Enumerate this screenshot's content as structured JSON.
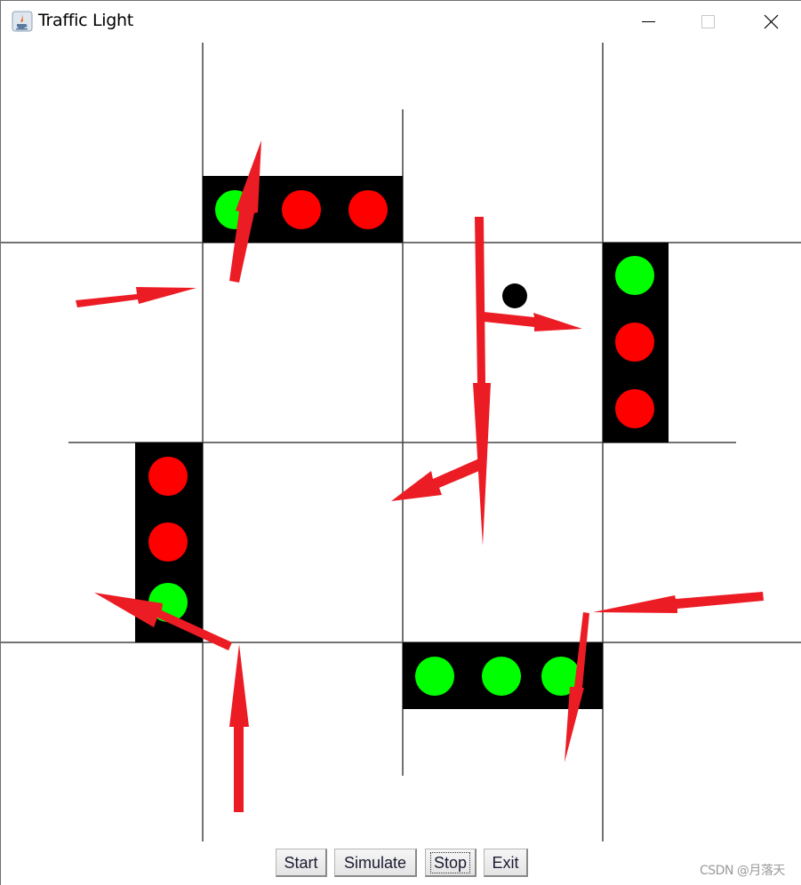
{
  "window": {
    "title": "Traffic Light",
    "controls": [
      "minimize",
      "maximize",
      "close"
    ]
  },
  "icons": {
    "app": "java-coffee-cup-icon",
    "minimize": "minimize-icon",
    "maximize": "maximize-icon",
    "close": "close-icon"
  },
  "colors": {
    "road_line": "#444444",
    "light_housing": "#000000",
    "green_on": "#00ff00",
    "red_on": "#ff0000",
    "arrow": "#ec1c24",
    "car": "#000000"
  },
  "traffic_lights": [
    {
      "id": "north",
      "orientation": "horizontal",
      "lights": [
        "green",
        "red",
        "red"
      ]
    },
    {
      "id": "east",
      "orientation": "vertical",
      "lights": [
        "green",
        "red",
        "red"
      ]
    },
    {
      "id": "west",
      "orientation": "vertical",
      "lights": [
        "red",
        "red",
        "green"
      ]
    },
    {
      "id": "south",
      "orientation": "horizontal",
      "lights": [
        "green",
        "green",
        "green"
      ]
    }
  ],
  "buttons": [
    {
      "label": "Start",
      "focused": false
    },
    {
      "label": "Simulate",
      "focused": false
    },
    {
      "label": "Stop",
      "focused": true
    },
    {
      "label": "Exit",
      "focused": false
    }
  ],
  "watermark": "CSDN @月落天"
}
